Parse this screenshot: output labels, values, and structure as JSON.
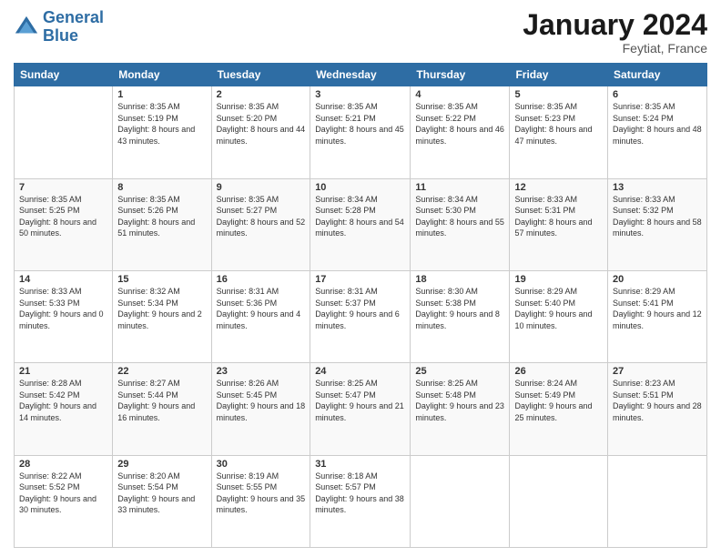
{
  "header": {
    "logo_line1": "General",
    "logo_line2": "Blue",
    "month_title": "January 2024",
    "location": "Feytiat, France"
  },
  "weekdays": [
    "Sunday",
    "Monday",
    "Tuesday",
    "Wednesday",
    "Thursday",
    "Friday",
    "Saturday"
  ],
  "weeks": [
    [
      {
        "day": "",
        "sunrise": "",
        "sunset": "",
        "daylight": ""
      },
      {
        "day": "1",
        "sunrise": "Sunrise: 8:35 AM",
        "sunset": "Sunset: 5:19 PM",
        "daylight": "Daylight: 8 hours and 43 minutes."
      },
      {
        "day": "2",
        "sunrise": "Sunrise: 8:35 AM",
        "sunset": "Sunset: 5:20 PM",
        "daylight": "Daylight: 8 hours and 44 minutes."
      },
      {
        "day": "3",
        "sunrise": "Sunrise: 8:35 AM",
        "sunset": "Sunset: 5:21 PM",
        "daylight": "Daylight: 8 hours and 45 minutes."
      },
      {
        "day": "4",
        "sunrise": "Sunrise: 8:35 AM",
        "sunset": "Sunset: 5:22 PM",
        "daylight": "Daylight: 8 hours and 46 minutes."
      },
      {
        "day": "5",
        "sunrise": "Sunrise: 8:35 AM",
        "sunset": "Sunset: 5:23 PM",
        "daylight": "Daylight: 8 hours and 47 minutes."
      },
      {
        "day": "6",
        "sunrise": "Sunrise: 8:35 AM",
        "sunset": "Sunset: 5:24 PM",
        "daylight": "Daylight: 8 hours and 48 minutes."
      }
    ],
    [
      {
        "day": "7",
        "sunrise": "Sunrise: 8:35 AM",
        "sunset": "Sunset: 5:25 PM",
        "daylight": "Daylight: 8 hours and 50 minutes."
      },
      {
        "day": "8",
        "sunrise": "Sunrise: 8:35 AM",
        "sunset": "Sunset: 5:26 PM",
        "daylight": "Daylight: 8 hours and 51 minutes."
      },
      {
        "day": "9",
        "sunrise": "Sunrise: 8:35 AM",
        "sunset": "Sunset: 5:27 PM",
        "daylight": "Daylight: 8 hours and 52 minutes."
      },
      {
        "day": "10",
        "sunrise": "Sunrise: 8:34 AM",
        "sunset": "Sunset: 5:28 PM",
        "daylight": "Daylight: 8 hours and 54 minutes."
      },
      {
        "day": "11",
        "sunrise": "Sunrise: 8:34 AM",
        "sunset": "Sunset: 5:30 PM",
        "daylight": "Daylight: 8 hours and 55 minutes."
      },
      {
        "day": "12",
        "sunrise": "Sunrise: 8:33 AM",
        "sunset": "Sunset: 5:31 PM",
        "daylight": "Daylight: 8 hours and 57 minutes."
      },
      {
        "day": "13",
        "sunrise": "Sunrise: 8:33 AM",
        "sunset": "Sunset: 5:32 PM",
        "daylight": "Daylight: 8 hours and 58 minutes."
      }
    ],
    [
      {
        "day": "14",
        "sunrise": "Sunrise: 8:33 AM",
        "sunset": "Sunset: 5:33 PM",
        "daylight": "Daylight: 9 hours and 0 minutes."
      },
      {
        "day": "15",
        "sunrise": "Sunrise: 8:32 AM",
        "sunset": "Sunset: 5:34 PM",
        "daylight": "Daylight: 9 hours and 2 minutes."
      },
      {
        "day": "16",
        "sunrise": "Sunrise: 8:31 AM",
        "sunset": "Sunset: 5:36 PM",
        "daylight": "Daylight: 9 hours and 4 minutes."
      },
      {
        "day": "17",
        "sunrise": "Sunrise: 8:31 AM",
        "sunset": "Sunset: 5:37 PM",
        "daylight": "Daylight: 9 hours and 6 minutes."
      },
      {
        "day": "18",
        "sunrise": "Sunrise: 8:30 AM",
        "sunset": "Sunset: 5:38 PM",
        "daylight": "Daylight: 9 hours and 8 minutes."
      },
      {
        "day": "19",
        "sunrise": "Sunrise: 8:29 AM",
        "sunset": "Sunset: 5:40 PM",
        "daylight": "Daylight: 9 hours and 10 minutes."
      },
      {
        "day": "20",
        "sunrise": "Sunrise: 8:29 AM",
        "sunset": "Sunset: 5:41 PM",
        "daylight": "Daylight: 9 hours and 12 minutes."
      }
    ],
    [
      {
        "day": "21",
        "sunrise": "Sunrise: 8:28 AM",
        "sunset": "Sunset: 5:42 PM",
        "daylight": "Daylight: 9 hours and 14 minutes."
      },
      {
        "day": "22",
        "sunrise": "Sunrise: 8:27 AM",
        "sunset": "Sunset: 5:44 PM",
        "daylight": "Daylight: 9 hours and 16 minutes."
      },
      {
        "day": "23",
        "sunrise": "Sunrise: 8:26 AM",
        "sunset": "Sunset: 5:45 PM",
        "daylight": "Daylight: 9 hours and 18 minutes."
      },
      {
        "day": "24",
        "sunrise": "Sunrise: 8:25 AM",
        "sunset": "Sunset: 5:47 PM",
        "daylight": "Daylight: 9 hours and 21 minutes."
      },
      {
        "day": "25",
        "sunrise": "Sunrise: 8:25 AM",
        "sunset": "Sunset: 5:48 PM",
        "daylight": "Daylight: 9 hours and 23 minutes."
      },
      {
        "day": "26",
        "sunrise": "Sunrise: 8:24 AM",
        "sunset": "Sunset: 5:49 PM",
        "daylight": "Daylight: 9 hours and 25 minutes."
      },
      {
        "day": "27",
        "sunrise": "Sunrise: 8:23 AM",
        "sunset": "Sunset: 5:51 PM",
        "daylight": "Daylight: 9 hours and 28 minutes."
      }
    ],
    [
      {
        "day": "28",
        "sunrise": "Sunrise: 8:22 AM",
        "sunset": "Sunset: 5:52 PM",
        "daylight": "Daylight: 9 hours and 30 minutes."
      },
      {
        "day": "29",
        "sunrise": "Sunrise: 8:20 AM",
        "sunset": "Sunset: 5:54 PM",
        "daylight": "Daylight: 9 hours and 33 minutes."
      },
      {
        "day": "30",
        "sunrise": "Sunrise: 8:19 AM",
        "sunset": "Sunset: 5:55 PM",
        "daylight": "Daylight: 9 hours and 35 minutes."
      },
      {
        "day": "31",
        "sunrise": "Sunrise: 8:18 AM",
        "sunset": "Sunset: 5:57 PM",
        "daylight": "Daylight: 9 hours and 38 minutes."
      },
      {
        "day": "",
        "sunrise": "",
        "sunset": "",
        "daylight": ""
      },
      {
        "day": "",
        "sunrise": "",
        "sunset": "",
        "daylight": ""
      },
      {
        "day": "",
        "sunrise": "",
        "sunset": "",
        "daylight": ""
      }
    ]
  ]
}
